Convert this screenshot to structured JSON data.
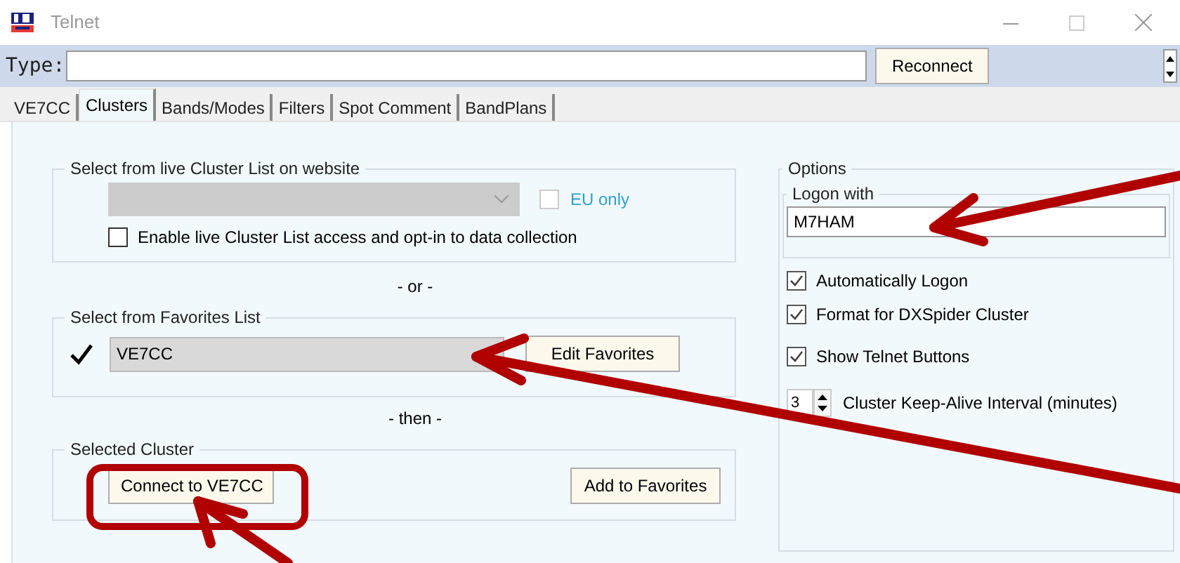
{
  "window": {
    "title": "Telnet"
  },
  "command": {
    "label": "Type:",
    "button": "Reconnect"
  },
  "tabs": [
    {
      "label": "VE7CC",
      "selected": false
    },
    {
      "label": "Clusters",
      "selected": true
    },
    {
      "label": "Bands/Modes",
      "selected": false
    },
    {
      "label": "Filters",
      "selected": false
    },
    {
      "label": "Spot Comment",
      "selected": false
    },
    {
      "label": "BandPlans",
      "selected": false
    }
  ],
  "live_cluster": {
    "title": "Select from live Cluster List on website",
    "eu_only": {
      "label": "EU only",
      "checked": false
    },
    "enable": {
      "label": "Enable live Cluster List access and opt-in to data collection",
      "checked": false
    }
  },
  "separator_or": "- or -",
  "favorites": {
    "title": "Select from Favorites List",
    "value": "VE7CC",
    "button": "Edit Favorites"
  },
  "separator_then": "- then -",
  "selected_cluster": {
    "title": "Selected Cluster",
    "connect_button": "Connect to VE7CC",
    "add_button": "Add to Favorites"
  },
  "options": {
    "title": "Options",
    "logon": {
      "title": "Logon with",
      "value": "M7HAM"
    },
    "checkboxes": [
      {
        "label": "Automatically Logon",
        "checked": true
      },
      {
        "label": "Format for DXSpider Cluster",
        "checked": true
      },
      {
        "label": "Show Telnet Buttons",
        "checked": true
      }
    ],
    "keep_alive": {
      "value": "3",
      "label": "Cluster Keep-Alive Interval (minutes)"
    }
  }
}
